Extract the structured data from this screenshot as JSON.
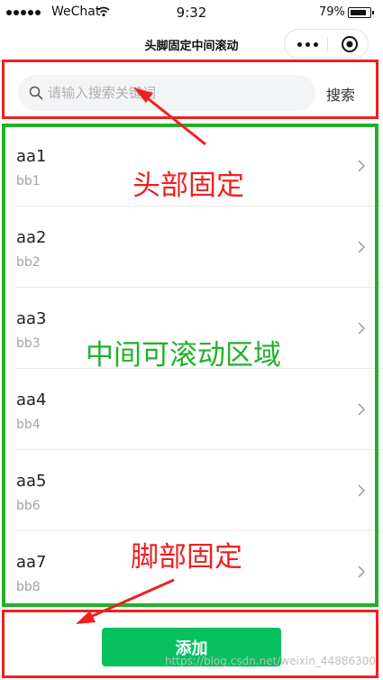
{
  "status_bar": {
    "carrier": "WeChat",
    "time": "9:32",
    "battery": "79%"
  },
  "nav": {
    "title": "头脚固定中间滚动"
  },
  "search": {
    "placeholder": "请输入搜索关键词",
    "value": "",
    "button_label": "搜索"
  },
  "list": {
    "items": [
      {
        "title": "aa1",
        "subtitle": "bb1"
      },
      {
        "title": "aa2",
        "subtitle": "bb2"
      },
      {
        "title": "aa3",
        "subtitle": "bb3"
      },
      {
        "title": "aa4",
        "subtitle": "bb4"
      },
      {
        "title": "aa5",
        "subtitle": "bb6"
      },
      {
        "title": "aa7",
        "subtitle": "bb8"
      }
    ]
  },
  "footer": {
    "add_label": "添加",
    "watermark": "https://blog.csdn.net/weixin_44886300"
  },
  "annotations": {
    "header": "头部固定",
    "list": "中间可滚动区域",
    "footer": "脚部固定"
  },
  "colors": {
    "accent_green": "#07c160",
    "annotation_red": "#ef2020",
    "annotation_green": "#22b02a"
  }
}
